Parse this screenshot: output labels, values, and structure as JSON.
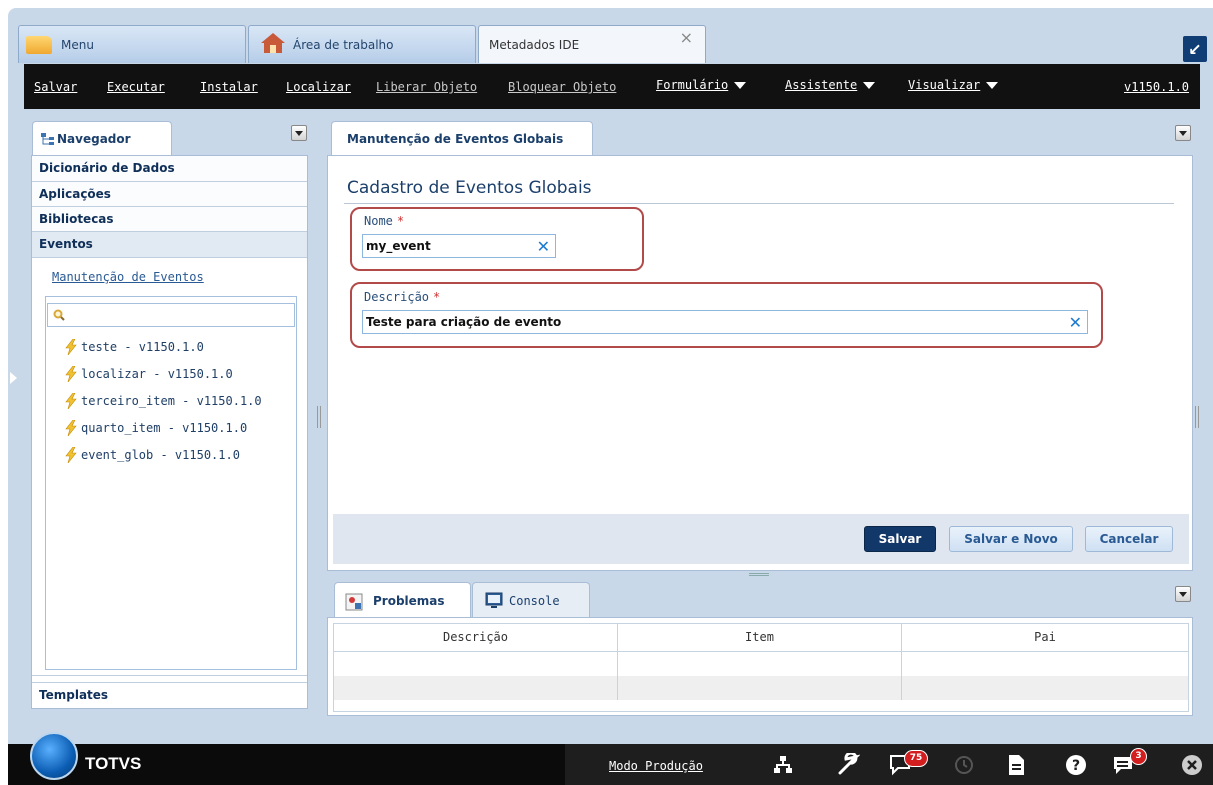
{
  "top_tabs": [
    {
      "label": "Menu"
    },
    {
      "label": "Área de trabalho"
    },
    {
      "label": "Metadados IDE"
    }
  ],
  "toolbar": {
    "items": [
      "Salvar",
      "Executar",
      "Instalar",
      "Localizar",
      "Liberar Objeto",
      "Bloquear Objeto",
      "Formulário",
      "Assistente",
      "Visualizar"
    ],
    "version": "v1150.1.0"
  },
  "navigator": {
    "tab_label": "Navegador",
    "sections": [
      "Dicionário de Dados",
      "Aplicações",
      "Bibliotecas",
      "Eventos"
    ],
    "link": "Manutenção de Eventos",
    "search_placeholder": "",
    "events": [
      "teste - v1150.1.0",
      "localizar - v1150.1.0",
      "terceiro_item - v1150.1.0",
      "quarto_item - v1150.1.0",
      "event_glob - v1150.1.0"
    ],
    "templates": "Templates"
  },
  "main": {
    "tab_label": "Manutenção de Eventos Globais",
    "title": "Cadastro de Eventos Globais",
    "nome_label": "Nome",
    "nome_value": "my_event",
    "descricao_label": "Descrição",
    "descricao_value": "Teste para criação de evento",
    "required_mark": "*",
    "clear_glyph": "✕",
    "buttons": {
      "save": "Salvar",
      "save_new": "Salvar e Novo",
      "cancel": "Cancelar"
    }
  },
  "bottom": {
    "tabs": [
      "Problemas",
      "Console"
    ],
    "columns": [
      "Descrição",
      "Item",
      "Pai"
    ]
  },
  "footer": {
    "brand": "TOTVS",
    "mode": "Modo Produção",
    "badges": {
      "messages": "75",
      "notifications": "3"
    }
  },
  "colors": {
    "accent": "#12386a",
    "highlight_border": "#b34a4a",
    "required": "#d23030",
    "toolbar_bg": "#111111"
  }
}
